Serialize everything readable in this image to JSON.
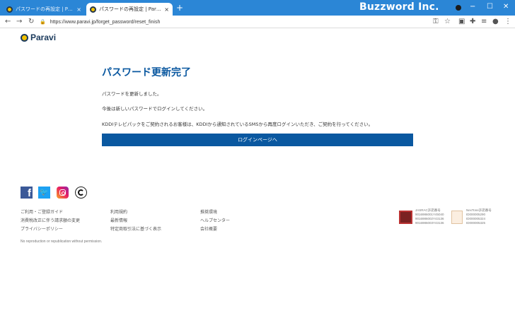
{
  "browser": {
    "tabs": [
      {
        "title": "パスワードの再設定 | Paravi(パラビ) ",
        "close": "×"
      },
      {
        "title": "パスワードの再設定 | Paravi(パラビ) ",
        "close": "×"
      }
    ],
    "new_tab": "+",
    "brand": "Buzzword Inc.",
    "url": "https://www.paravi.jp/forget_password/reset_finish"
  },
  "header": {
    "logo_text": "Paravi"
  },
  "main": {
    "title": "パスワード更新完了",
    "paragraphs": [
      "パスワードを更新しました。",
      "今後は新しいパスワードでログインしてください。",
      "KDDIテレビパックをご契約されるお客様は、KDDIから通知されているSMSから再度ログインいただき、ご契約を行ってください。"
    ],
    "login_button": "ログインページへ"
  },
  "footer": {
    "col1": [
      "ご利用・ご登録ガイド",
      "消費税改正に伴う請求額の変更",
      "プライバシーポリシー"
    ],
    "col2": [
      "利用規約",
      "最新情報",
      "特定商取引法に基づく表示"
    ],
    "col3": [
      "推奨環境",
      "ヘルプセンター",
      "会社概要"
    ],
    "jasrac": [
      "JASRAC許諾番号",
      "9016986001Y45040",
      "9016986002Y43136",
      "9016986003Y43136"
    ],
    "nextone": [
      "NexTone許諾番号",
      "ID000005290",
      "ID000005324",
      "ID000005325"
    ],
    "copyright": "No reproduction or republication without permission."
  }
}
